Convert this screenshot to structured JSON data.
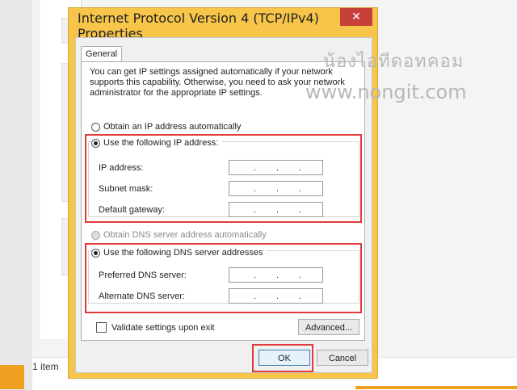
{
  "dialog": {
    "title": "Internet Protocol Version 4 (TCP/IPv4) Properties",
    "close_glyph": "✕",
    "tabs": [
      "General"
    ]
  },
  "general": {
    "description": "You can get IP settings assigned automatically if your network supports this capability. Otherwise, you need to ask your network administrator for the appropriate IP settings.",
    "ip_auto_label": "Obtain an IP address automatically",
    "ip_manual_label": "Use the following IP address:",
    "ip_fields": [
      {
        "label": "IP address:",
        "value": ". . ."
      },
      {
        "label": "Subnet mask:",
        "value": ". . ."
      },
      {
        "label": "Default gateway:",
        "value": ". . ."
      }
    ],
    "dns_auto_label": "Obtain DNS server address automatically",
    "dns_manual_label": "Use the following DNS server addresses",
    "dns_fields": [
      {
        "label": "Preferred DNS server:",
        "value": ". . ."
      },
      {
        "label": "Alternate DNS server:",
        "value": ". . ."
      }
    ],
    "validate_label": "Validate settings upon exit",
    "advanced_label": "Advanced..."
  },
  "buttons": {
    "ok": "OK",
    "cancel": "Cancel"
  },
  "background": {
    "status_text": "1 item"
  },
  "watermark": {
    "line1": "น้องไอทีดอทคอม",
    "line2": "www.nongit.com"
  },
  "colors": {
    "dialog_frame": "#f6c54a",
    "close_button": "#c7403a",
    "highlight": "#e23a3a"
  }
}
